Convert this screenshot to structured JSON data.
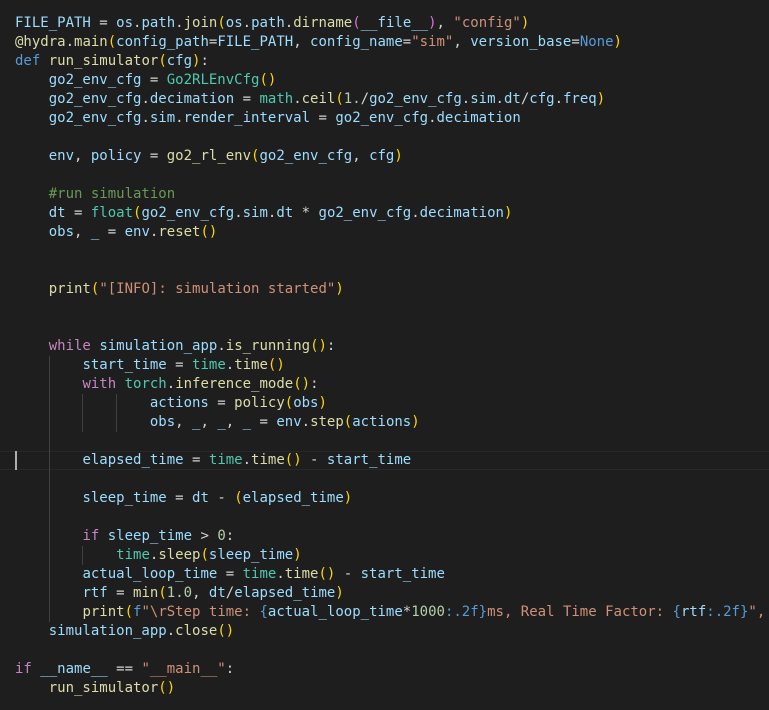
{
  "editor": {
    "language": "python",
    "colors": {
      "background": "#1e1e1e",
      "keyword": "#569cd6",
      "control": "#c586c0",
      "function": "#dcdcaa",
      "variable": "#9cdcfe",
      "class": "#4ec9b0",
      "string": "#ce9178",
      "number": "#b5cea8",
      "comment": "#6a9955",
      "plain": "#d4d4d4",
      "bracket1": "#ffd700",
      "bracket2": "#da70d6",
      "bracket3": "#179fff"
    },
    "cursor_line": 23,
    "lines": [
      {
        "indent": 0,
        "tokens": [
          [
            "var",
            "FILE_PATH"
          ],
          [
            "plain",
            " = "
          ],
          [
            "var",
            "os"
          ],
          [
            "plain",
            "."
          ],
          [
            "var",
            "path"
          ],
          [
            "plain",
            "."
          ],
          [
            "fn",
            "join"
          ],
          [
            "b1",
            "("
          ],
          [
            "var",
            "os"
          ],
          [
            "plain",
            "."
          ],
          [
            "var",
            "path"
          ],
          [
            "plain",
            "."
          ],
          [
            "fn",
            "dirname"
          ],
          [
            "b2",
            "("
          ],
          [
            "var",
            "__file__"
          ],
          [
            "b2",
            ")"
          ],
          [
            "plain",
            ", "
          ],
          [
            "str",
            "\"config\""
          ],
          [
            "b1",
            ")"
          ]
        ]
      },
      {
        "indent": 0,
        "tokens": [
          [
            "fn",
            "@hydra"
          ],
          [
            "plain",
            "."
          ],
          [
            "fn",
            "main"
          ],
          [
            "b1",
            "("
          ],
          [
            "var",
            "config_path"
          ],
          [
            "plain",
            "="
          ],
          [
            "var",
            "FILE_PATH"
          ],
          [
            "plain",
            ", "
          ],
          [
            "var",
            "config_name"
          ],
          [
            "plain",
            "="
          ],
          [
            "str",
            "\"sim\""
          ],
          [
            "plain",
            ", "
          ],
          [
            "var",
            "version_base"
          ],
          [
            "plain",
            "="
          ],
          [
            "kw",
            "None"
          ],
          [
            "b1",
            ")"
          ]
        ]
      },
      {
        "indent": 0,
        "tokens": [
          [
            "kw",
            "def"
          ],
          [
            "plain",
            " "
          ],
          [
            "fn",
            "run_simulator"
          ],
          [
            "b1",
            "("
          ],
          [
            "var",
            "cfg"
          ],
          [
            "b1",
            ")"
          ],
          [
            "plain",
            ":"
          ]
        ]
      },
      {
        "indent": 1,
        "tokens": [
          [
            "var",
            "go2_env_cfg"
          ],
          [
            "plain",
            " = "
          ],
          [
            "cls",
            "Go2RLEnvCfg"
          ],
          [
            "b1",
            "()"
          ]
        ]
      },
      {
        "indent": 1,
        "tokens": [
          [
            "var",
            "go2_env_cfg"
          ],
          [
            "plain",
            "."
          ],
          [
            "var",
            "decimation"
          ],
          [
            "plain",
            " = "
          ],
          [
            "cls",
            "math"
          ],
          [
            "plain",
            "."
          ],
          [
            "fn",
            "ceil"
          ],
          [
            "b1",
            "("
          ],
          [
            "num",
            "1."
          ],
          [
            "plain",
            "/"
          ],
          [
            "var",
            "go2_env_cfg"
          ],
          [
            "plain",
            "."
          ],
          [
            "var",
            "sim"
          ],
          [
            "plain",
            "."
          ],
          [
            "var",
            "dt"
          ],
          [
            "plain",
            "/"
          ],
          [
            "var",
            "cfg"
          ],
          [
            "plain",
            "."
          ],
          [
            "var",
            "freq"
          ],
          [
            "b1",
            ")"
          ]
        ]
      },
      {
        "indent": 1,
        "tokens": [
          [
            "var",
            "go2_env_cfg"
          ],
          [
            "plain",
            "."
          ],
          [
            "var",
            "sim"
          ],
          [
            "plain",
            "."
          ],
          [
            "var",
            "render_interval"
          ],
          [
            "plain",
            " = "
          ],
          [
            "var",
            "go2_env_cfg"
          ],
          [
            "plain",
            "."
          ],
          [
            "var",
            "decimation"
          ]
        ]
      },
      {
        "indent": 1,
        "tokens": []
      },
      {
        "indent": 1,
        "tokens": [
          [
            "var",
            "env"
          ],
          [
            "plain",
            ", "
          ],
          [
            "var",
            "policy"
          ],
          [
            "plain",
            " = "
          ],
          [
            "fn",
            "go2_rl_env"
          ],
          [
            "b1",
            "("
          ],
          [
            "var",
            "go2_env_cfg"
          ],
          [
            "plain",
            ", "
          ],
          [
            "var",
            "cfg"
          ],
          [
            "b1",
            ")"
          ]
        ]
      },
      {
        "indent": 1,
        "tokens": []
      },
      {
        "indent": 1,
        "tokens": [
          [
            "com",
            "#run simulation"
          ]
        ]
      },
      {
        "indent": 1,
        "tokens": [
          [
            "var",
            "dt"
          ],
          [
            "plain",
            " = "
          ],
          [
            "cls",
            "float"
          ],
          [
            "b1",
            "("
          ],
          [
            "var",
            "go2_env_cfg"
          ],
          [
            "plain",
            "."
          ],
          [
            "var",
            "sim"
          ],
          [
            "plain",
            "."
          ],
          [
            "var",
            "dt"
          ],
          [
            "plain",
            " * "
          ],
          [
            "var",
            "go2_env_cfg"
          ],
          [
            "plain",
            "."
          ],
          [
            "var",
            "decimation"
          ],
          [
            "b1",
            ")"
          ]
        ]
      },
      {
        "indent": 1,
        "tokens": [
          [
            "var",
            "obs"
          ],
          [
            "plain",
            ", "
          ],
          [
            "var",
            "_"
          ],
          [
            "plain",
            " = "
          ],
          [
            "var",
            "env"
          ],
          [
            "plain",
            "."
          ],
          [
            "fn",
            "reset"
          ],
          [
            "b1",
            "()"
          ]
        ]
      },
      {
        "indent": 1,
        "tokens": []
      },
      {
        "indent": 1,
        "tokens": []
      },
      {
        "indent": 1,
        "tokens": [
          [
            "fn",
            "print"
          ],
          [
            "b1",
            "("
          ],
          [
            "str",
            "\"[INFO]: simulation started\""
          ],
          [
            "b1",
            ")"
          ]
        ]
      },
      {
        "indent": 1,
        "tokens": []
      },
      {
        "indent": 1,
        "tokens": []
      },
      {
        "indent": 1,
        "tokens": [
          [
            "ctl",
            "while"
          ],
          [
            "plain",
            " "
          ],
          [
            "var",
            "simulation_app"
          ],
          [
            "plain",
            "."
          ],
          [
            "fn",
            "is_running"
          ],
          [
            "b1",
            "()"
          ],
          [
            "plain",
            ":"
          ]
        ]
      },
      {
        "indent": 2,
        "tokens": [
          [
            "var",
            "start_time"
          ],
          [
            "plain",
            " = "
          ],
          [
            "cls",
            "time"
          ],
          [
            "plain",
            "."
          ],
          [
            "fn",
            "time"
          ],
          [
            "b1",
            "()"
          ]
        ]
      },
      {
        "indent": 2,
        "tokens": [
          [
            "ctl",
            "with"
          ],
          [
            "plain",
            " "
          ],
          [
            "cls",
            "torch"
          ],
          [
            "plain",
            "."
          ],
          [
            "fn",
            "inference_mode"
          ],
          [
            "b1",
            "()"
          ],
          [
            "plain",
            ":"
          ]
        ]
      },
      {
        "indent": 4,
        "tokens": [
          [
            "var",
            "actions"
          ],
          [
            "plain",
            " = "
          ],
          [
            "fn",
            "policy"
          ],
          [
            "b1",
            "("
          ],
          [
            "var",
            "obs"
          ],
          [
            "b1",
            ")"
          ]
        ]
      },
      {
        "indent": 4,
        "tokens": [
          [
            "var",
            "obs"
          ],
          [
            "plain",
            ", "
          ],
          [
            "var",
            "_"
          ],
          [
            "plain",
            ", "
          ],
          [
            "var",
            "_"
          ],
          [
            "plain",
            ", "
          ],
          [
            "var",
            "_"
          ],
          [
            "plain",
            " = "
          ],
          [
            "var",
            "env"
          ],
          [
            "plain",
            "."
          ],
          [
            "fn",
            "step"
          ],
          [
            "b1",
            "("
          ],
          [
            "var",
            "actions"
          ],
          [
            "b1",
            ")"
          ]
        ]
      },
      {
        "indent": 2,
        "tokens": []
      },
      {
        "indent": 2,
        "tokens": [
          [
            "var",
            "elapsed_time"
          ],
          [
            "plain",
            " = "
          ],
          [
            "cls",
            "time"
          ],
          [
            "plain",
            "."
          ],
          [
            "fn",
            "time"
          ],
          [
            "b1",
            "()"
          ],
          [
            "plain",
            " - "
          ],
          [
            "var",
            "start_time"
          ]
        ]
      },
      {
        "indent": 2,
        "tokens": []
      },
      {
        "indent": 2,
        "tokens": [
          [
            "var",
            "sleep_time"
          ],
          [
            "plain",
            " = "
          ],
          [
            "var",
            "dt"
          ],
          [
            "plain",
            " - "
          ],
          [
            "b1",
            "("
          ],
          [
            "var",
            "elapsed_time"
          ],
          [
            "b1",
            ")"
          ]
        ]
      },
      {
        "indent": 2,
        "tokens": []
      },
      {
        "indent": 2,
        "tokens": [
          [
            "ctl",
            "if"
          ],
          [
            "plain",
            " "
          ],
          [
            "var",
            "sleep_time"
          ],
          [
            "plain",
            " > "
          ],
          [
            "num",
            "0"
          ],
          [
            "plain",
            ":"
          ]
        ]
      },
      {
        "indent": 3,
        "tokens": [
          [
            "cls",
            "time"
          ],
          [
            "plain",
            "."
          ],
          [
            "fn",
            "sleep"
          ],
          [
            "b1",
            "("
          ],
          [
            "var",
            "sleep_time"
          ],
          [
            "b1",
            ")"
          ]
        ]
      },
      {
        "indent": 2,
        "tokens": [
          [
            "var",
            "actual_loop_time"
          ],
          [
            "plain",
            " = "
          ],
          [
            "cls",
            "time"
          ],
          [
            "plain",
            "."
          ],
          [
            "fn",
            "time"
          ],
          [
            "b1",
            "()"
          ],
          [
            "plain",
            " - "
          ],
          [
            "var",
            "start_time"
          ]
        ]
      },
      {
        "indent": 2,
        "tokens": [
          [
            "var",
            "rtf"
          ],
          [
            "plain",
            " = "
          ],
          [
            "fn",
            "min"
          ],
          [
            "b1",
            "("
          ],
          [
            "num",
            "1.0"
          ],
          [
            "plain",
            ", "
          ],
          [
            "var",
            "dt"
          ],
          [
            "plain",
            "/"
          ],
          [
            "var",
            "elapsed_time"
          ],
          [
            "b1",
            ")"
          ]
        ]
      },
      {
        "indent": 2,
        "tokens": [
          [
            "fn",
            "print"
          ],
          [
            "b1",
            "("
          ],
          [
            "kw",
            "f"
          ],
          [
            "str",
            "\"\\rStep time: "
          ],
          [
            "kw",
            "{"
          ],
          [
            "var",
            "actual_loop_time"
          ],
          [
            "plain",
            "*"
          ],
          [
            "num",
            "1000"
          ],
          [
            "kw",
            ":.2f"
          ],
          [
            "kw",
            "}"
          ],
          [
            "str",
            "ms, Real Time Factor: "
          ],
          [
            "kw",
            "{"
          ],
          [
            "var",
            "rtf"
          ],
          [
            "kw",
            ":.2f"
          ],
          [
            "kw",
            "}"
          ],
          [
            "str",
            "\","
          ]
        ]
      },
      {
        "indent": 1,
        "tokens": [
          [
            "var",
            "simulation_app"
          ],
          [
            "plain",
            "."
          ],
          [
            "fn",
            "close"
          ],
          [
            "b1",
            "()"
          ]
        ]
      },
      {
        "indent": 0,
        "tokens": []
      },
      {
        "indent": 0,
        "tokens": [
          [
            "ctl",
            "if"
          ],
          [
            "plain",
            " "
          ],
          [
            "var",
            "__name__"
          ],
          [
            "plain",
            " == "
          ],
          [
            "str",
            "\"__main__\""
          ],
          [
            "plain",
            ":"
          ]
        ]
      },
      {
        "indent": 1,
        "tokens": [
          [
            "fn",
            "run_simulator"
          ],
          [
            "b1",
            "()"
          ]
        ]
      }
    ]
  }
}
